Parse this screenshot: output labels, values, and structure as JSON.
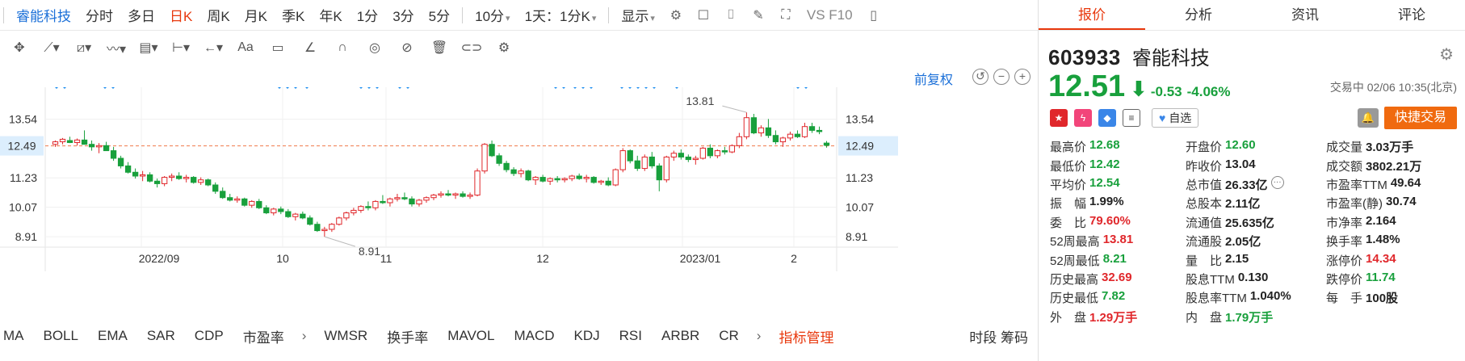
{
  "toolbar_periods": [
    {
      "label": "睿能科技",
      "style": "blue"
    },
    {
      "label": "分时",
      "style": "normal"
    },
    {
      "label": "多日",
      "style": "normal"
    },
    {
      "label": "日K",
      "style": "active"
    },
    {
      "label": "周K",
      "style": "normal"
    },
    {
      "label": "月K",
      "style": "normal"
    },
    {
      "label": "季K",
      "style": "normal"
    },
    {
      "label": "年K",
      "style": "normal"
    },
    {
      "label": "1分",
      "style": "normal"
    },
    {
      "label": "3分",
      "style": "normal"
    },
    {
      "label": "5分",
      "style": "normal"
    },
    {
      "label": "10分",
      "style": "dropdown"
    },
    {
      "label": "1天：1分K",
      "style": "dropdown"
    },
    {
      "label": "显示",
      "style": "dropdown"
    }
  ],
  "toolbar_right_text": "VS F10",
  "fuquan_label": "前复权",
  "chart_data": {
    "type": "candlestick",
    "x_tick_labels": [
      "2022/09",
      "10",
      "11",
      "12",
      "2023/01",
      "2"
    ],
    "y_tick_labels": [
      "13.54",
      "12.49",
      "11.23",
      "10.07",
      "8.91"
    ],
    "current_price_label": "12.49",
    "ylim": [
      8.5,
      14.1
    ],
    "annotations": [
      {
        "text": "13.81",
        "value": 13.81
      },
      {
        "text": "8.91",
        "value": 8.91
      }
    ],
    "candles": [
      [
        12.55,
        12.7,
        12.45,
        12.65
      ],
      [
        12.65,
        12.8,
        12.55,
        12.75
      ],
      [
        12.7,
        12.85,
        12.6,
        12.62
      ],
      [
        12.62,
        12.78,
        12.5,
        12.72
      ],
      [
        12.72,
        13.1,
        12.6,
        12.55
      ],
      [
        12.55,
        12.7,
        12.3,
        12.45
      ],
      [
        12.45,
        12.6,
        12.2,
        12.5
      ],
      [
        12.5,
        12.65,
        12.35,
        12.3
      ],
      [
        12.3,
        12.45,
        11.9,
        12.0
      ],
      [
        12.0,
        12.1,
        11.6,
        11.7
      ],
      [
        11.7,
        11.85,
        11.4,
        11.45
      ],
      [
        11.45,
        11.6,
        11.2,
        11.3
      ],
      [
        11.3,
        11.5,
        11.1,
        11.35
      ],
      [
        11.35,
        11.45,
        11.05,
        11.1
      ],
      [
        11.1,
        11.2,
        10.85,
        11.0
      ],
      [
        11.0,
        11.3,
        10.9,
        11.25
      ],
      [
        11.25,
        11.4,
        11.1,
        11.3
      ],
      [
        11.3,
        11.45,
        11.15,
        11.2
      ],
      [
        11.2,
        11.35,
        11.05,
        11.25
      ],
      [
        11.25,
        11.3,
        11.0,
        11.05
      ],
      [
        11.05,
        11.25,
        10.95,
        11.15
      ],
      [
        11.15,
        11.2,
        10.9,
        10.95
      ],
      [
        10.95,
        11.05,
        10.6,
        10.7
      ],
      [
        10.7,
        10.85,
        10.4,
        10.45
      ],
      [
        10.45,
        10.6,
        10.3,
        10.35
      ],
      [
        10.35,
        10.5,
        10.25,
        10.4
      ],
      [
        10.4,
        10.45,
        10.1,
        10.15
      ],
      [
        10.15,
        10.35,
        10.05,
        10.3
      ],
      [
        10.3,
        10.4,
        10.0,
        10.05
      ],
      [
        10.05,
        10.15,
        9.8,
        9.85
      ],
      [
        9.85,
        10.05,
        9.75,
        10.0
      ],
      [
        10.0,
        10.1,
        9.8,
        9.9
      ],
      [
        9.9,
        10.0,
        9.65,
        9.7
      ],
      [
        9.7,
        9.85,
        9.55,
        9.8
      ],
      [
        9.8,
        9.9,
        9.6,
        9.65
      ],
      [
        9.65,
        9.75,
        9.35,
        9.4
      ],
      [
        9.4,
        9.5,
        9.1,
        9.15
      ],
      [
        9.15,
        9.3,
        8.91,
        9.2
      ],
      [
        9.2,
        9.45,
        9.1,
        9.4
      ],
      [
        9.4,
        9.7,
        9.35,
        9.65
      ],
      [
        9.65,
        9.9,
        9.55,
        9.85
      ],
      [
        9.85,
        10.05,
        9.75,
        9.95
      ],
      [
        9.95,
        10.15,
        9.85,
        10.1
      ],
      [
        10.1,
        10.3,
        9.95,
        10.05
      ],
      [
        10.05,
        10.35,
        9.95,
        10.3
      ],
      [
        10.3,
        10.55,
        10.2,
        10.25
      ],
      [
        10.25,
        10.45,
        10.1,
        10.4
      ],
      [
        10.4,
        10.6,
        10.3,
        10.45
      ],
      [
        10.45,
        10.65,
        10.35,
        10.4
      ],
      [
        10.4,
        10.5,
        10.1,
        10.2
      ],
      [
        10.2,
        10.4,
        10.1,
        10.35
      ],
      [
        10.35,
        10.5,
        10.25,
        10.45
      ],
      [
        10.45,
        10.6,
        10.35,
        10.55
      ],
      [
        10.55,
        10.7,
        10.45,
        10.6
      ],
      [
        10.6,
        10.75,
        10.5,
        10.55
      ],
      [
        10.55,
        10.65,
        10.4,
        10.6
      ],
      [
        10.6,
        10.7,
        10.45,
        10.5
      ],
      [
        10.5,
        10.65,
        10.4,
        10.55
      ],
      [
        10.55,
        11.6,
        10.5,
        11.5
      ],
      [
        11.5,
        12.6,
        11.4,
        12.55
      ],
      [
        12.55,
        12.7,
        12.05,
        12.1
      ],
      [
        12.1,
        12.2,
        11.7,
        11.8
      ],
      [
        11.8,
        11.9,
        11.45,
        11.55
      ],
      [
        11.55,
        11.65,
        11.3,
        11.4
      ],
      [
        11.4,
        11.6,
        11.25,
        11.5
      ],
      [
        11.5,
        11.55,
        11.1,
        11.15
      ],
      [
        11.15,
        11.3,
        10.95,
        11.25
      ],
      [
        11.25,
        11.35,
        11.05,
        11.1
      ],
      [
        11.1,
        11.25,
        10.95,
        11.2
      ],
      [
        11.2,
        11.3,
        11.05,
        11.15
      ],
      [
        11.15,
        11.25,
        11.05,
        11.2
      ],
      [
        11.2,
        11.35,
        11.1,
        11.3
      ],
      [
        11.3,
        11.4,
        11.15,
        11.2
      ],
      [
        11.2,
        11.35,
        11.05,
        11.25
      ],
      [
        11.25,
        11.3,
        11.0,
        11.05
      ],
      [
        11.05,
        11.15,
        10.95,
        11.1
      ],
      [
        11.1,
        11.25,
        10.9,
        10.95
      ],
      [
        10.95,
        11.6,
        10.9,
        11.55
      ],
      [
        11.55,
        12.4,
        11.45,
        12.3
      ],
      [
        12.3,
        12.35,
        11.8,
        11.9
      ],
      [
        11.9,
        12.1,
        11.5,
        11.6
      ],
      [
        11.6,
        12.15,
        11.5,
        12.05
      ],
      [
        12.05,
        12.25,
        11.6,
        11.7
      ],
      [
        11.7,
        11.8,
        10.7,
        11.15
      ],
      [
        11.15,
        12.1,
        11.05,
        12.05
      ],
      [
        12.05,
        12.3,
        11.9,
        12.2
      ],
      [
        12.2,
        12.35,
        11.95,
        12.05
      ],
      [
        12.05,
        12.15,
        11.85,
        11.95
      ],
      [
        11.95,
        12.1,
        11.75,
        12.0
      ],
      [
        12.0,
        12.45,
        11.95,
        12.4
      ],
      [
        12.4,
        12.55,
        12.0,
        12.1
      ],
      [
        12.1,
        12.35,
        12.0,
        12.3
      ],
      [
        12.3,
        12.45,
        12.15,
        12.25
      ],
      [
        12.25,
        12.55,
        12.2,
        12.5
      ],
      [
        12.5,
        13.0,
        12.4,
        12.85
      ],
      [
        12.85,
        13.81,
        12.75,
        13.6
      ],
      [
        13.6,
        13.75,
        12.95,
        13.0
      ],
      [
        13.0,
        13.3,
        12.85,
        13.2
      ],
      [
        13.2,
        13.55,
        12.8,
        12.9
      ],
      [
        12.9,
        13.1,
        12.55,
        12.65
      ],
      [
        12.65,
        12.85,
        12.45,
        12.8
      ],
      [
        12.8,
        13.05,
        12.7,
        12.95
      ],
      [
        12.95,
        13.1,
        12.8,
        12.85
      ],
      [
        12.85,
        13.4,
        12.8,
        13.25
      ],
      [
        13.25,
        13.4,
        13.0,
        13.1
      ],
      [
        13.1,
        13.25,
        12.95,
        13.05
      ],
      [
        12.6,
        12.68,
        12.42,
        12.51
      ]
    ]
  },
  "indicators": [
    "MA",
    "BOLL",
    "EMA",
    "SAR",
    "CDP",
    "市盈率",
    "WMSR",
    "换手率",
    "MAVOL",
    "MACD",
    "KDJ",
    "RSI",
    "ARBR",
    "CR"
  ],
  "indicator_manage": "指标管理",
  "indicators_right": "时段 筹码",
  "tabs": [
    "报价",
    "分析",
    "资讯",
    "评论"
  ],
  "stock": {
    "code": "603933",
    "name": "睿能科技",
    "price": "12.51",
    "change": "-0.53",
    "pct": "-4.06%",
    "status": "交易中 02/06 10:35(北京)",
    "zixuan": "自选",
    "quick_trade": "快捷交易"
  },
  "stats": [
    [
      {
        "l": "最高价",
        "v": "12.68",
        "c": "green"
      },
      {
        "l": "开盘价",
        "v": "12.60",
        "c": "green"
      },
      {
        "l": "成交量",
        "v": "3.03万手",
        "c": "dark"
      }
    ],
    [
      {
        "l": "最低价",
        "v": "12.42",
        "c": "green"
      },
      {
        "l": "昨收价",
        "v": "13.04",
        "c": "dark"
      },
      {
        "l": "成交额",
        "v": "3802.21万",
        "c": "dark"
      }
    ],
    [
      {
        "l": "平均价",
        "v": "12.54",
        "c": "green"
      },
      {
        "l": "总市值",
        "v": "26.33亿",
        "c": "dark",
        "more": true
      },
      {
        "l": "市盈率TTM",
        "v": "49.64",
        "c": "dark"
      }
    ],
    [
      {
        "l": "振　幅",
        "v": "1.99%",
        "c": "dark"
      },
      {
        "l": "总股本",
        "v": "2.11亿",
        "c": "dark"
      },
      {
        "l": "市盈率(静)",
        "v": "30.74",
        "c": "dark"
      }
    ],
    [
      {
        "l": "委　比",
        "v": "79.60%",
        "c": "red"
      },
      {
        "l": "流通值",
        "v": "25.635亿",
        "c": "dark"
      },
      {
        "l": "市净率",
        "v": "2.164",
        "c": "dark"
      }
    ],
    [
      {
        "l": "52周最高",
        "v": "13.81",
        "c": "red"
      },
      {
        "l": "流通股",
        "v": "2.05亿",
        "c": "dark"
      },
      {
        "l": "换手率",
        "v": "1.48%",
        "c": "dark"
      }
    ],
    [
      {
        "l": "52周最低",
        "v": "8.21",
        "c": "green"
      },
      {
        "l": "量　比",
        "v": "2.15",
        "c": "dark"
      },
      {
        "l": "涨停价",
        "v": "14.34",
        "c": "red"
      }
    ],
    [
      {
        "l": "历史最高",
        "v": "32.69",
        "c": "red"
      },
      {
        "l": "股息TTM",
        "v": "0.130",
        "c": "dark"
      },
      {
        "l": "跌停价",
        "v": "11.74",
        "c": "green"
      }
    ],
    [
      {
        "l": "历史最低",
        "v": "7.82",
        "c": "green"
      },
      {
        "l": "股息率TTM",
        "v": "1.040%",
        "c": "dark"
      },
      {
        "l": "每　手",
        "v": "100股",
        "c": "dark"
      }
    ],
    [
      {
        "l": "外　盘",
        "v": "1.29万手",
        "c": "red"
      },
      {
        "l": "内　盘",
        "v": "1.79万手",
        "c": "green"
      },
      {
        "l": "",
        "v": "",
        "c": "dark"
      }
    ]
  ],
  "colors": {
    "up": "#e0272b",
    "down": "#18a03c",
    "accent": "#e8380d",
    "link": "#1a6fd8",
    "marker": "#1a8cf0"
  }
}
